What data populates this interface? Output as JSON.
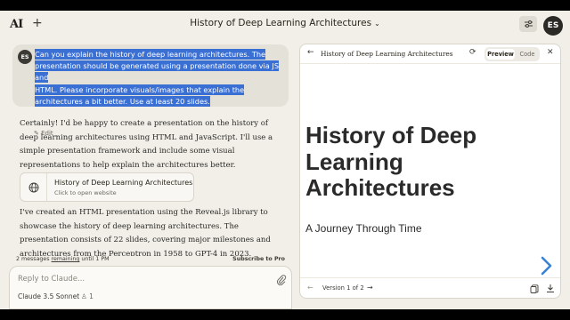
{
  "app": {
    "logo": "AI",
    "new_chat": "+",
    "title": "History of Deep Learning Architectures",
    "title_chevron": "⌄",
    "user_initials": "ES"
  },
  "user_message": {
    "initials": "ES",
    "lines": [
      "Can you explain the history of deep learning architectures. The",
      "presentation should be generated using a presentation done via JS and",
      "HTML. Please incorporate visuals/images that explain the",
      "architectures a bit better. Use at least 20 slides."
    ],
    "edit_label": "Edit"
  },
  "assistant": {
    "paragraph1": "Certainly! I'd be happy to create a presentation on the history of deep learning architectures using HTML and JavaScript. I'll use a simple presentation framework and include some visual representations to help explain the architectures better.",
    "artifact_card": {
      "title": "History of Deep Learning Architectures",
      "subtitle": "Click to open website"
    },
    "paragraph2": "I've created an HTML presentation using the Reveal.js library to showcase the history of deep learning architectures. The presentation consists of 22 slides, covering major milestones and architectures from the Perceptron in 1958 to GPT-4 in 2023."
  },
  "limits": {
    "prefix": "2 messages ",
    "underlined": "remaining",
    "suffix": " until 1 PM",
    "subscribe": "Subscribe to Pro"
  },
  "composer": {
    "placeholder": "Reply to Claude...",
    "model": "Claude 3.5 Sonnet",
    "users_count": "1"
  },
  "artifact_panel": {
    "title": "History of Deep Learning Architectures",
    "toggle": {
      "preview": "Preview",
      "code": "Code"
    },
    "slide": {
      "title": "History of Deep Learning Architectures",
      "subtitle": "A Journey Through Time"
    },
    "version": "Version 1 of 2"
  },
  "colors": {
    "background": "#f1efe8",
    "selection": "#3a6fd4",
    "slide_arrow": "#3b82d0"
  }
}
